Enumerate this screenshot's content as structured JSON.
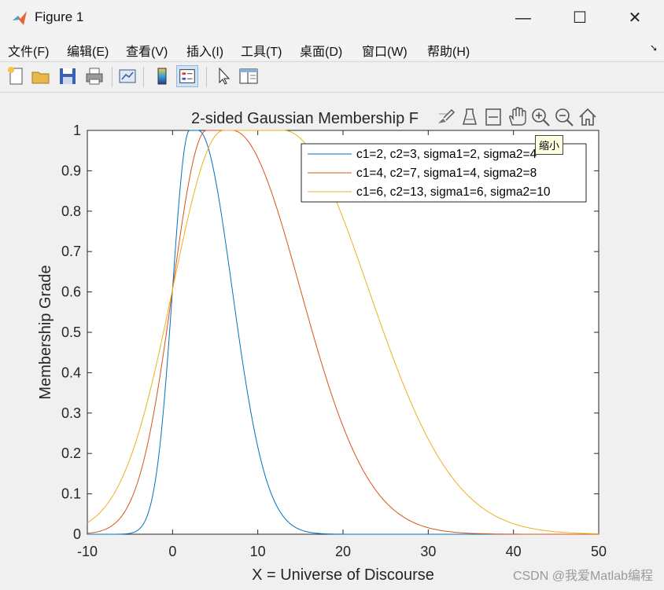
{
  "window": {
    "title": "Figure 1",
    "minimize": "—",
    "maximize": "☐",
    "close": "✕"
  },
  "menu": [
    "文件(F)",
    "编辑(E)",
    "查看(V)",
    "插入(I)",
    "工具(T)",
    "桌面(D)",
    "窗口(W)",
    "帮助(H)"
  ],
  "toolbar_icons": [
    "new-figure-icon",
    "open-file-icon",
    "save-icon",
    "print-icon",
    "link-plot-icon",
    "colorbar-icon",
    "legend-icon",
    "pointer-icon",
    "property-inspector-icon"
  ],
  "axes_toolbar_icons": [
    "brush-icon",
    "data-tips-icon",
    "restore-view-icon",
    "pan-icon",
    "zoom-in-icon",
    "zoom-out-icon",
    "home-icon"
  ],
  "tooltip": "缩小",
  "watermark": "CSDN @我爱Matlab编程",
  "colors": {
    "series1": "#0072BD",
    "series2": "#D95319",
    "series3": "#EDB120"
  },
  "chart_data": {
    "type": "line",
    "title": "2-sided Gaussian Membership F",
    "xlabel": "X = Universe of Discourse",
    "ylabel": "Membership Grade",
    "xlim": [
      -10,
      50
    ],
    "ylim": [
      0,
      1
    ],
    "xticks": [
      -10,
      0,
      10,
      20,
      30,
      40,
      50
    ],
    "yticks": [
      0,
      0.1,
      0.2,
      0.3,
      0.4,
      0.5,
      0.6,
      0.7,
      0.8,
      0.9,
      1
    ],
    "grid": false,
    "legend_position": "top-right",
    "series": [
      {
        "name": "c1=2, c2=3, sigma1=2, sigma2=4",
        "c1": 2,
        "c2": 3,
        "sigma1": 2,
        "sigma2": 4
      },
      {
        "name": "c1=4, c2=7, sigma1=4, sigma2=8",
        "c1": 4,
        "c2": 7,
        "sigma1": 4,
        "sigma2": 8
      },
      {
        "name": "c1=6, c2=13, sigma1=6, sigma2=10",
        "c1": 6,
        "c2": 13,
        "sigma1": 6,
        "sigma2": 10
      }
    ]
  }
}
